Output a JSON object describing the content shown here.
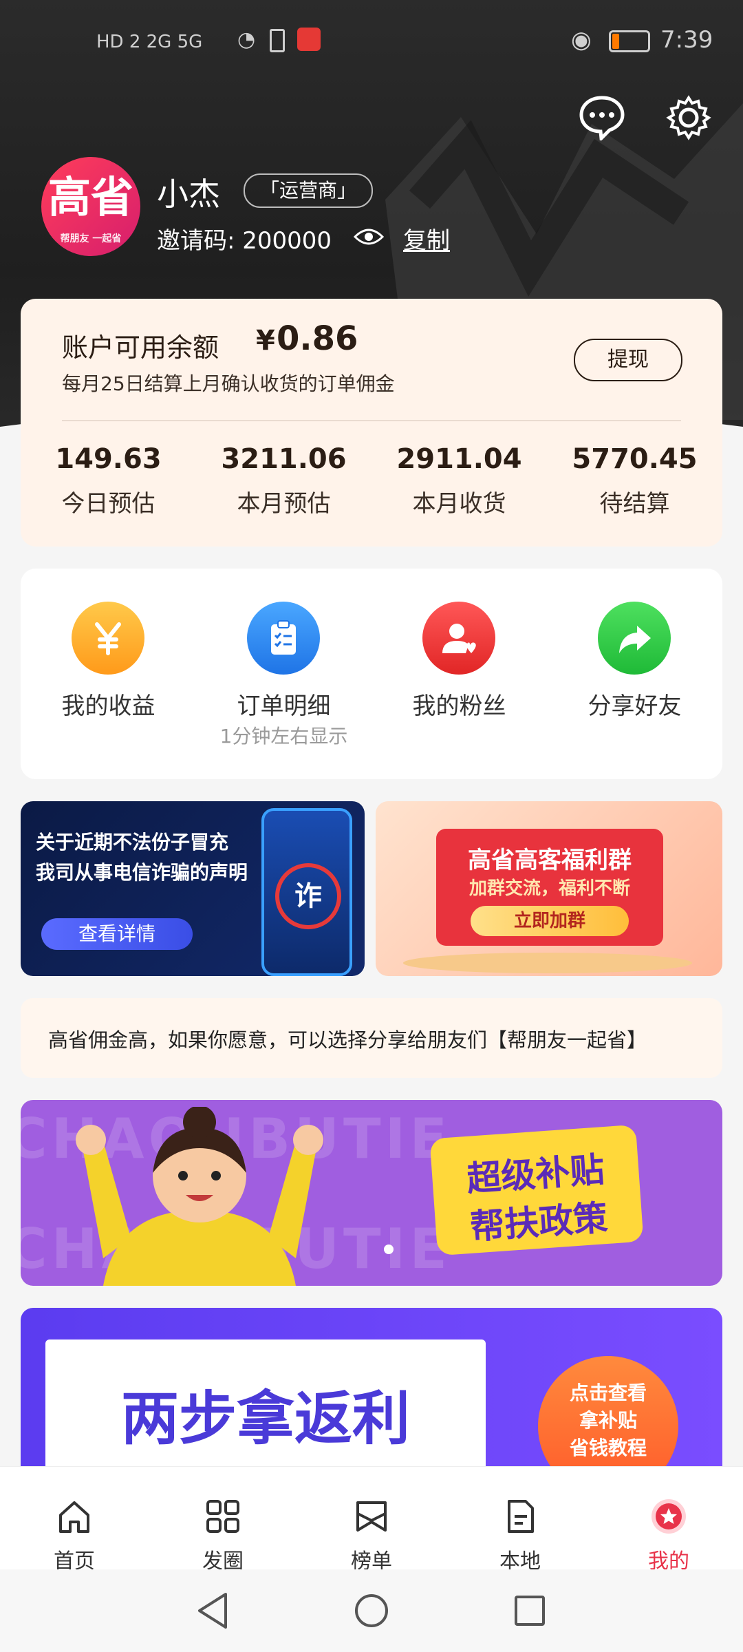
{
  "status_bar": {
    "left": "HD 2 2G 5G",
    "time": "7:39"
  },
  "profile": {
    "avatar_text": "高省",
    "avatar_sub": "帮朋友 一起省",
    "name": "小杰",
    "role_badge": "「运营商」",
    "invite_label": "邀请码: ",
    "invite_code": "200000",
    "copy_label": "复制"
  },
  "balance": {
    "title": "账户可用余额",
    "currency": "¥",
    "amount": "0.86",
    "note": "每月25日结算上月确认收货的订单佣金",
    "withdraw_label": "提现",
    "stats": [
      {
        "value": "149.63",
        "label": "今日预估"
      },
      {
        "value": "3211.06",
        "label": "本月预估"
      },
      {
        "value": "2911.04",
        "label": "本月收货"
      },
      {
        "value": "5770.45",
        "label": "待结算"
      }
    ]
  },
  "menu": {
    "items": [
      {
        "label": "我的收益",
        "sub": "",
        "icon": "yen-icon",
        "color": "#ffb12a"
      },
      {
        "label": "订单明细",
        "sub": "1分钟左右显示",
        "icon": "clipboard-icon",
        "color": "#2e8cf0"
      },
      {
        "label": "我的粉丝",
        "sub": "",
        "icon": "user-heart-icon",
        "color": "#f03838"
      },
      {
        "label": "分享好友",
        "sub": "",
        "icon": "share-arrow-icon",
        "color": "#2fcf4c"
      }
    ]
  },
  "banners": {
    "notice": {
      "line1": "关于近期不法份子冒充",
      "line2": "我司从事电信诈骗的声明",
      "button": "查看详情",
      "badge": "诈"
    },
    "group": {
      "title": "高省高客福利群",
      "sub": "加群交流，福利不断",
      "button": "立即加群"
    }
  },
  "tip_text": "高省佣金高，如果你愿意，可以选择分享给朋友们【帮朋友一起省】",
  "subsidy_banner": {
    "bg_text": "CHAOJIBUTIE",
    "line1": "超级补贴",
    "line2": "帮扶政策"
  },
  "rebate_banner": {
    "title": "两步拿返利",
    "bubble1": "点击查看",
    "bubble2": "拿补贴",
    "bubble3": "省钱教程"
  },
  "bottom_nav": [
    {
      "label": "首页",
      "icon": "home-icon",
      "active": false
    },
    {
      "label": "发圈",
      "icon": "grid-icon",
      "active": false
    },
    {
      "label": "榜单",
      "icon": "ribbon-icon",
      "active": false
    },
    {
      "label": "本地",
      "icon": "document-icon",
      "active": false
    },
    {
      "label": "我的",
      "icon": "star-badge-icon",
      "active": true
    }
  ],
  "colors": {
    "accent": "#e8334a",
    "balance_bg": "#fff3ea",
    "header_bg": "#262626"
  }
}
